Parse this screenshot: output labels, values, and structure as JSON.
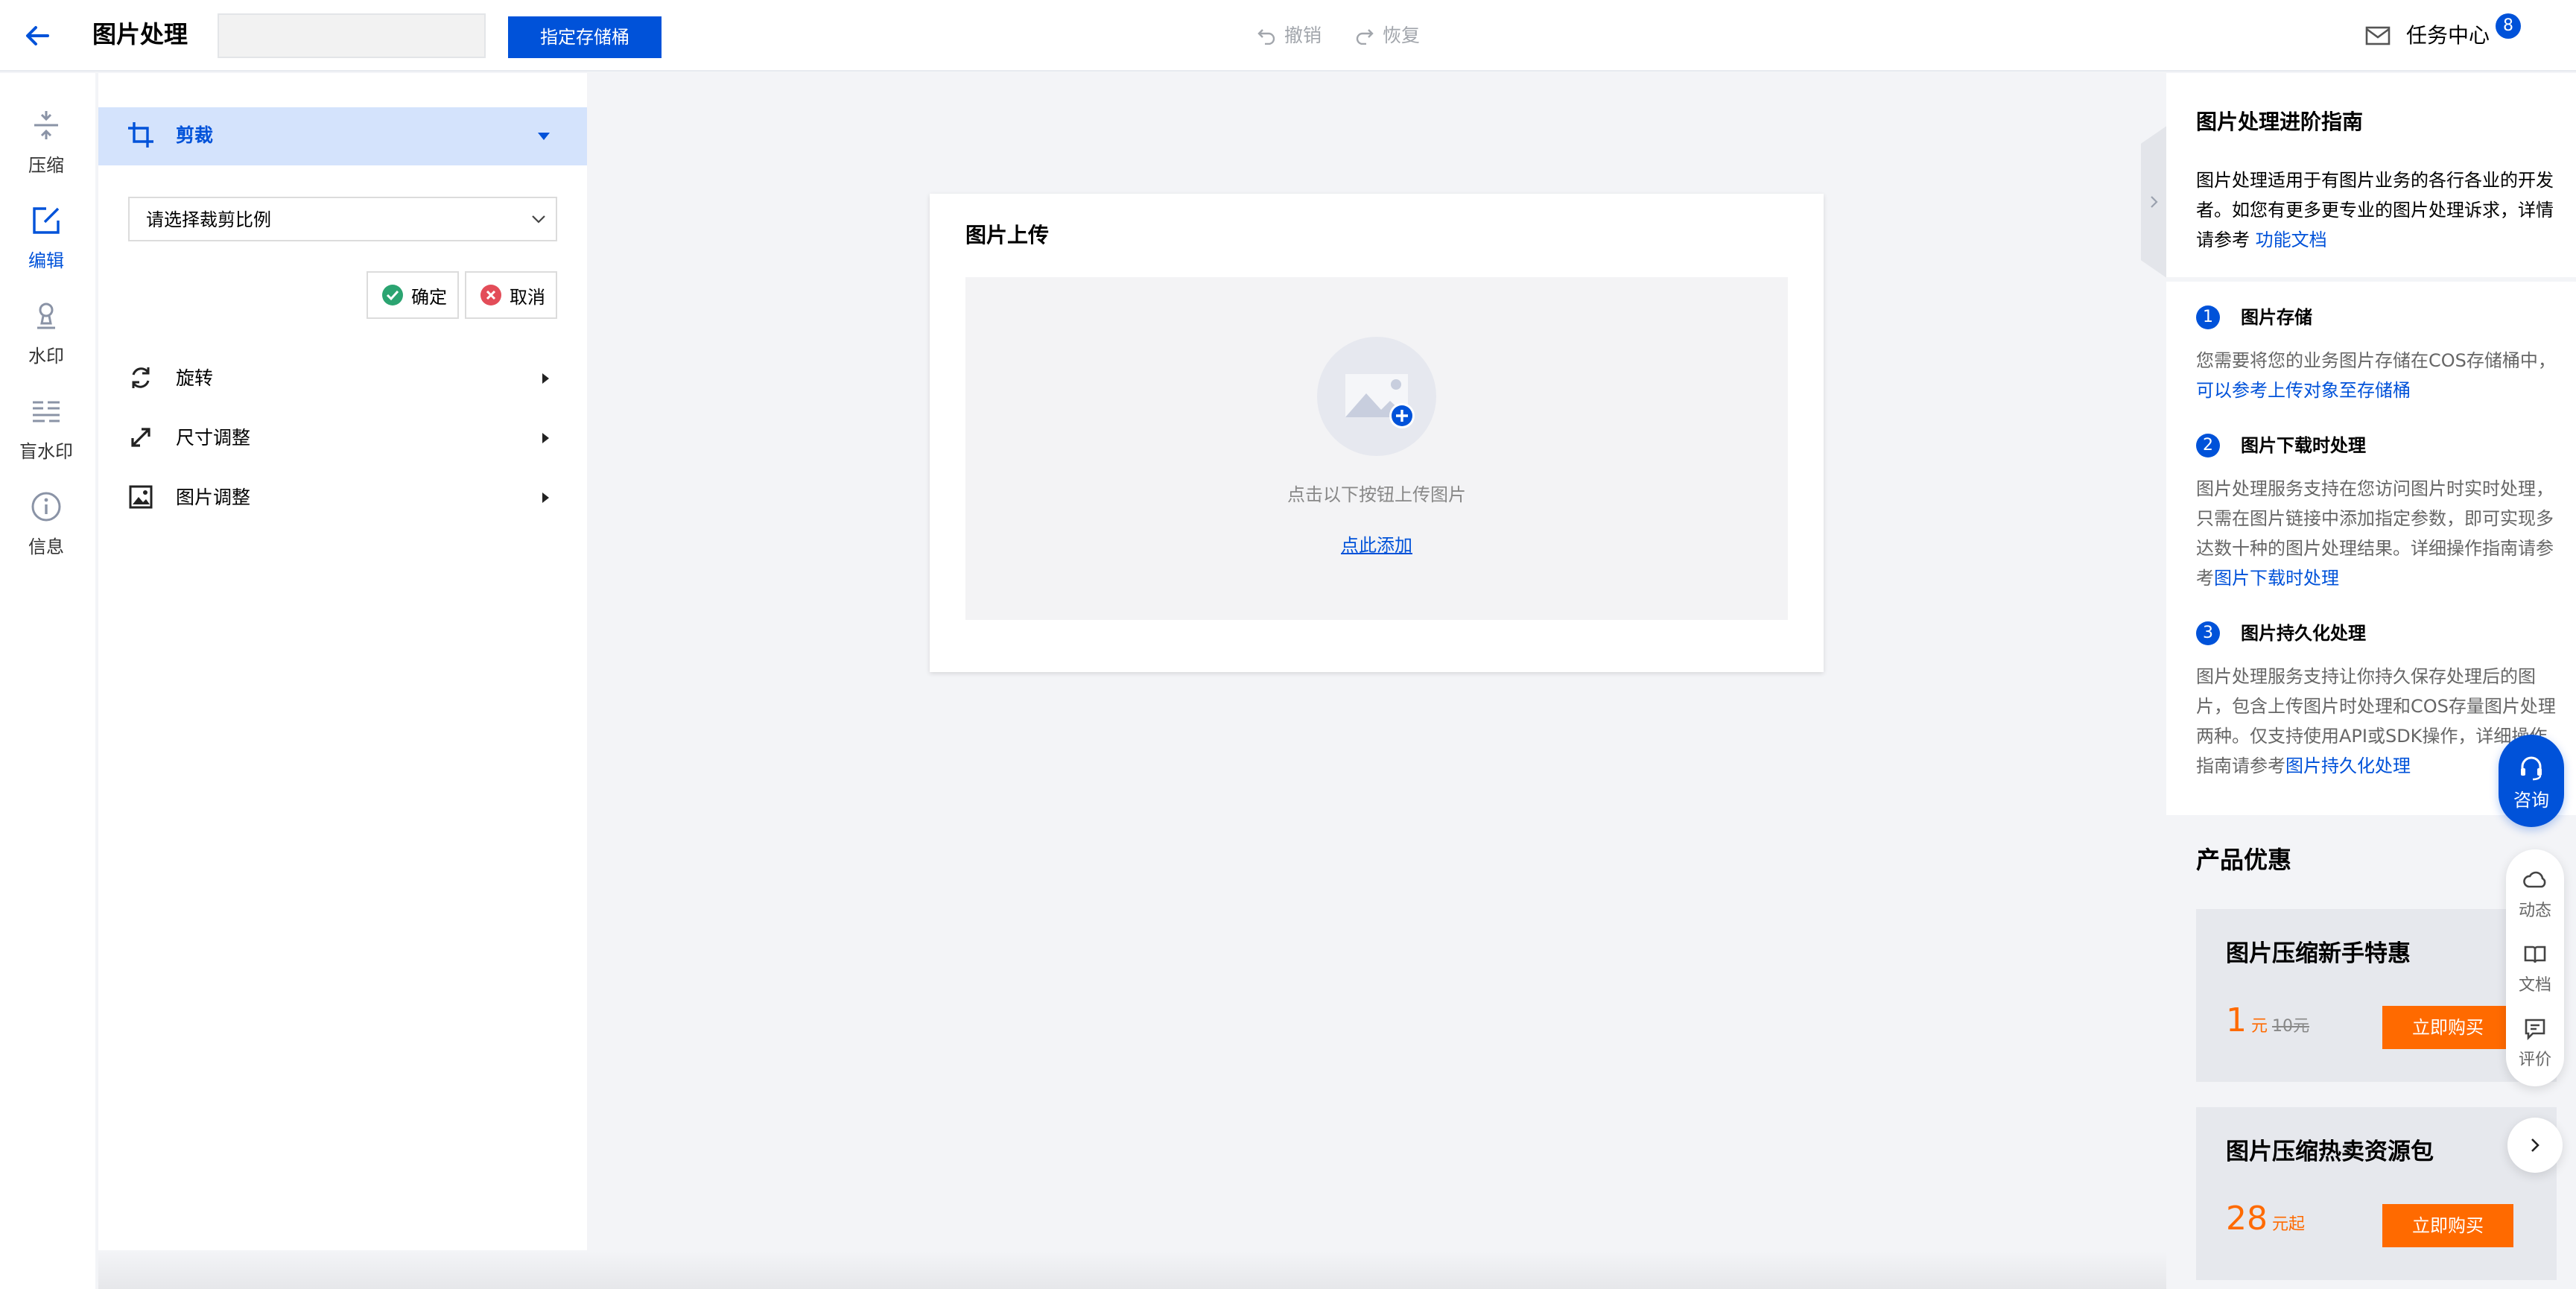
{
  "header": {
    "title": "图片处理",
    "bucket_placeholder": "",
    "bucket_button": "指定存储桶",
    "undo_label": "撤销",
    "redo_label": "恢复",
    "task_center_label": "任务中心",
    "task_count": "8"
  },
  "sidebar": {
    "items": [
      {
        "label": "压缩",
        "icon": "compress-icon"
      },
      {
        "label": "编辑",
        "icon": "edit-icon",
        "active": true
      },
      {
        "label": "水印",
        "icon": "watermark-icon"
      },
      {
        "label": "盲水印",
        "icon": "blind-watermark-icon"
      },
      {
        "label": "信息",
        "icon": "info-icon"
      }
    ]
  },
  "panel": {
    "crop_label": "剪裁",
    "crop_select_value": "请选择裁剪比例",
    "confirm_label": "确定",
    "cancel_label": "取消",
    "sections": [
      {
        "label": "旋转",
        "icon": "rotate-icon"
      },
      {
        "label": "尺寸调整",
        "icon": "resize-icon"
      },
      {
        "label": "图片调整",
        "icon": "image-adjust-icon"
      }
    ]
  },
  "upload": {
    "title": "图片上传",
    "hint": "点击以下按钮上传图片",
    "link": "点此添加"
  },
  "guide": {
    "title": "图片处理进阶指南",
    "intro_text": "图片处理适用于有图片业务的各行各业的开发者。如您有更多更专业的图片处理诉求，详情请参考",
    "intro_link": "功能文档",
    "steps": [
      {
        "num": "1",
        "title": "图片存储",
        "text": "您需要将您的业务图片存储在COS存储桶中，",
        "link": "可以参考上传对象至存储桶"
      },
      {
        "num": "2",
        "title": "图片下载时处理",
        "text": "图片处理服务支持在您访问图片时实时处理，只需在图片链接中添加指定参数，即可实现多达数十种的图片处理结果。详细操作指南请参考",
        "link": "图片下载时处理"
      },
      {
        "num": "3",
        "title": "图片持久化处理",
        "text": "图片处理服务支持让你持久保存处理后的图片，包含上传图片时处理和COS存量图片处理两种。仅支持使用API或SDK操作，详细操作指南请参考",
        "link": "图片持久化处理"
      }
    ]
  },
  "promo": {
    "title": "产品优惠",
    "cards": [
      {
        "name": "图片压缩新手特惠",
        "price": "1",
        "unit": "元",
        "old_price": "10元",
        "buy": "立即购买"
      },
      {
        "name": "图片压缩热卖资源包",
        "price": "28",
        "unit": "元起",
        "old_price": "",
        "buy": "立即购买"
      }
    ]
  },
  "floating": {
    "consult": "咨询",
    "items": [
      "动态",
      "文档",
      "评价"
    ]
  },
  "colors": {
    "accent": "#0052d9",
    "active_bg": "#d4e3fc",
    "promo": "#ff6a00"
  }
}
